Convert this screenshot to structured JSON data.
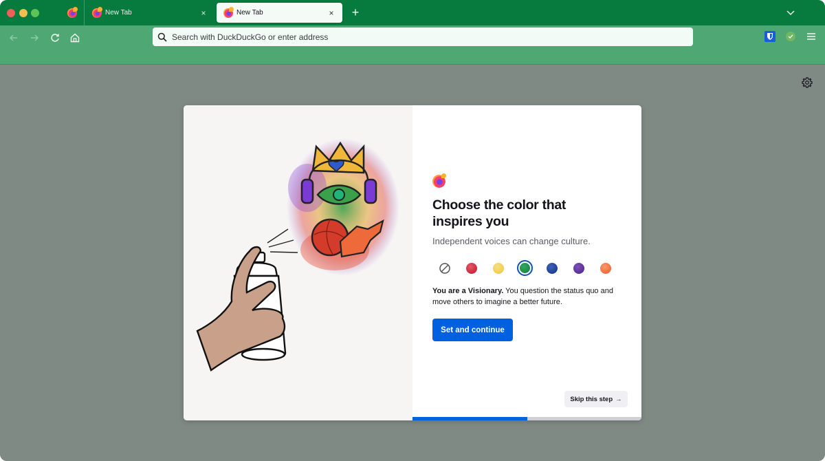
{
  "browser": {
    "window_controls": [
      "close",
      "minimize",
      "maximize"
    ],
    "pinned_tab": {
      "icon": "firefox-icon"
    },
    "tabs": [
      {
        "title": "New Tab",
        "icon": "firefox-icon",
        "active": false,
        "close_label": "×"
      },
      {
        "title": "New Tab",
        "icon": "firefox-icon",
        "active": true,
        "close_label": "×"
      }
    ],
    "new_tab_label": "+",
    "tab_list_icon": "chevron-down-icon"
  },
  "toolbar": {
    "back_icon": "arrow-left-icon",
    "forward_icon": "arrow-right-icon",
    "reload_icon": "reload-icon",
    "home_icon": "home-icon",
    "url_placeholder": "Search with DuckDuckGo or enter address",
    "url_value": "",
    "extensions": [
      {
        "name": "bitwarden-icon",
        "color": "#175ddc"
      },
      {
        "name": "shield-check-icon",
        "color": "#7fbf5a"
      }
    ],
    "menu_icon": "hamburger-menu-icon"
  },
  "content": {
    "settings_icon": "gear-icon",
    "onboarding": {
      "title": "Choose the color that inspires you",
      "subtitle": "Independent voices can change culture.",
      "colors": [
        {
          "name": "none",
          "color": "",
          "selected": false
        },
        {
          "name": "red",
          "color": "#c8283b",
          "selected": false
        },
        {
          "name": "yellow",
          "color": "#f0cd52",
          "selected": false
        },
        {
          "name": "green",
          "color": "#1b8a45",
          "selected": true
        },
        {
          "name": "blue",
          "color": "#1d3f93",
          "selected": false
        },
        {
          "name": "purple",
          "color": "#5b2e95",
          "selected": false
        },
        {
          "name": "orange",
          "color": "#f26a3a",
          "selected": false
        }
      ],
      "description_bold": "You are a Visionary.",
      "description_rest": " You question the status quo and move others to imagine a better future.",
      "primary_button": "Set and continue",
      "skip_button": "Skip this step",
      "skip_arrow": "→",
      "progress_fraction": 0.5
    }
  },
  "colors": {
    "tabstrip": "#077a3d",
    "toolbar": "#4fa873",
    "content_bg": "#808a85",
    "accent": "#0061e0"
  }
}
